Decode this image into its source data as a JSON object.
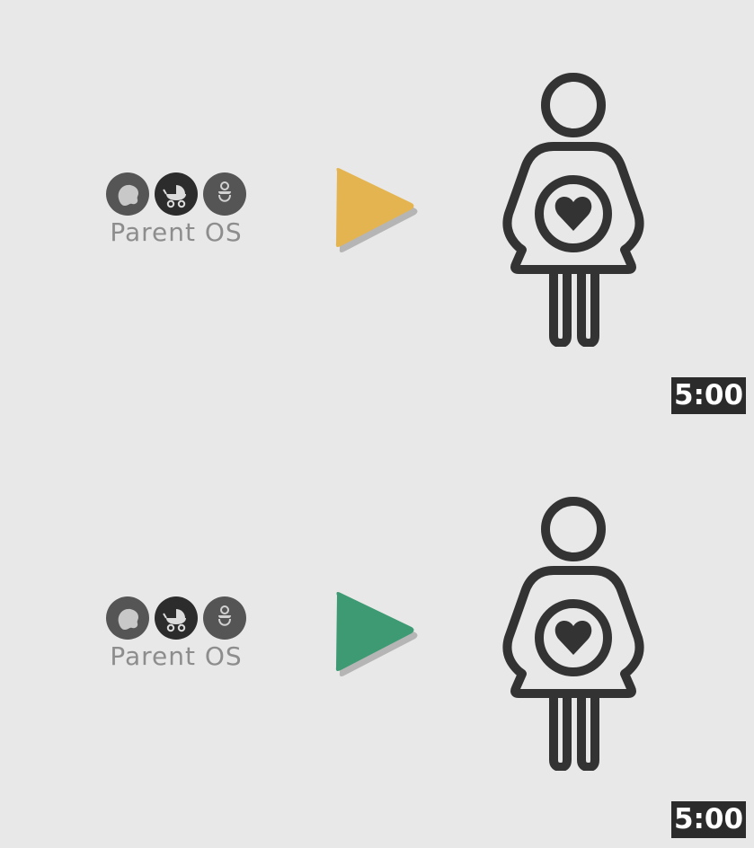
{
  "videos": [
    {
      "brand_text": "Parent OS",
      "duration": "5:00",
      "play_color": "#e4b451",
      "icons": {
        "logo_left": "fetus-icon",
        "logo_center": "stroller-icon",
        "logo_right": "pacifier-icon",
        "thumbnail": "pregnant-woman-heart-icon",
        "play": "play-icon"
      }
    },
    {
      "brand_text": "Parent OS",
      "duration": "5:00",
      "play_color": "#3d9a72",
      "icons": {
        "logo_left": "fetus-icon",
        "logo_center": "stroller-icon",
        "logo_right": "pacifier-icon",
        "thumbnail": "pregnant-woman-heart-icon",
        "play": "play-icon"
      }
    }
  ],
  "colors": {
    "background": "#e8e8e8",
    "icon_dark": "#333333",
    "badge_bg": "#2b2b2b",
    "brand_text": "#8d8d8d"
  }
}
